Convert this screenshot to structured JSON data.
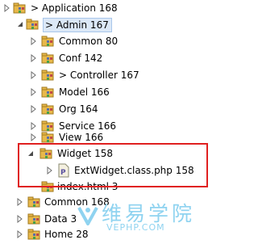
{
  "tree": {
    "items": [
      {
        "label": "> Application 168",
        "arrow": "collapsed",
        "icon": "package-folder-icon",
        "selected": false
      },
      {
        "label": "> Admin 167",
        "arrow": "expanded",
        "icon": "package-folder-icon",
        "selected": true
      },
      {
        "label": "Common 80",
        "arrow": "collapsed",
        "icon": "package-folder-icon",
        "selected": false
      },
      {
        "label": "Conf 142",
        "arrow": "collapsed",
        "icon": "package-folder-icon",
        "selected": false
      },
      {
        "label": "> Controller 167",
        "arrow": "collapsed",
        "icon": "package-folder-icon",
        "selected": false
      },
      {
        "label": "Model 166",
        "arrow": "collapsed",
        "icon": "package-folder-icon",
        "selected": false
      },
      {
        "label": "Org 164",
        "arrow": "collapsed",
        "icon": "package-folder-icon",
        "selected": false
      },
      {
        "label": "Service 166",
        "arrow": "collapsed",
        "icon": "package-folder-icon",
        "selected": false
      },
      {
        "label": "View 166",
        "arrow": "collapsed",
        "icon": "package-folder-icon",
        "selected": false
      },
      {
        "label": "Widget 158",
        "arrow": "expanded",
        "icon": "package-folder-icon",
        "selected": false
      },
      {
        "label": "ExtWidget.class.php 158",
        "arrow": "collapsed",
        "icon": "php-file-icon",
        "selected": false
      },
      {
        "label": "index.html 3",
        "arrow": "none",
        "icon": "package-folder-icon",
        "selected": false
      },
      {
        "label": "Common 168",
        "arrow": "collapsed",
        "icon": "package-folder-icon",
        "selected": false
      },
      {
        "label": "Data 3",
        "arrow": "collapsed",
        "icon": "package-folder-icon",
        "selected": false
      },
      {
        "label": "Home 28",
        "arrow": "collapsed",
        "icon": "package-folder-icon",
        "selected": false
      }
    ]
  },
  "watermark": {
    "chinese": "维易学院",
    "english": "VEPHP.COM"
  },
  "colors": {
    "highlight_box": "#e02020",
    "selection_bg": "#dbe8f7",
    "folder": "#e8b84a",
    "watermark": "#8fd3f0"
  }
}
